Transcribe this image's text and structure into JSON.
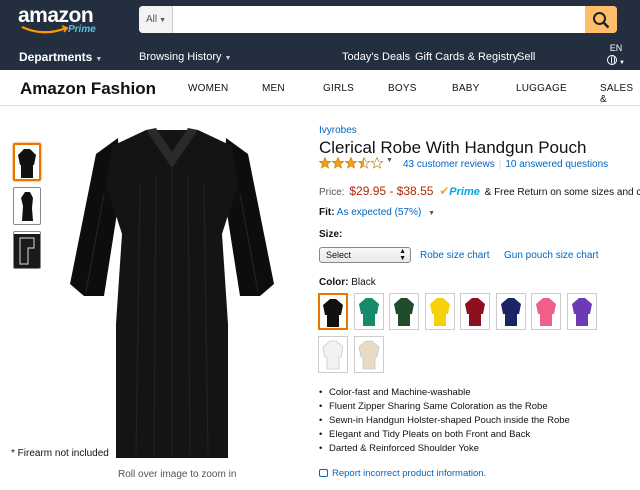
{
  "header": {
    "logo_text": "amazon",
    "logo_prime": "Prime",
    "search": {
      "category": "All",
      "value": "",
      "placeholder": ""
    },
    "departments": "Departments",
    "browsing_history": "Browsing History",
    "links": [
      "Today's Deals",
      "Gift Cards & Registry",
      "Sell"
    ],
    "language": "EN"
  },
  "subnav": {
    "brand": "Amazon Fashion",
    "categories": [
      "WOMEN",
      "MEN",
      "GIRLS",
      "BOYS",
      "BABY",
      "LUGGAGE",
      "SALES &"
    ]
  },
  "gallery": {
    "thumbnails": [
      "gown-front",
      "gown-side",
      "gown-pouch-detail"
    ],
    "selected_thumbnail": 0,
    "note": "* Firearm not included",
    "zoom_hint": "Roll over image to zoom in"
  },
  "product": {
    "brand": "Ivyrobes",
    "title": "Clerical Robe With Handgun Pouch",
    "rating": 3.5,
    "reviews": "43 customer reviews",
    "answered": "10 answered questions",
    "price_label": "Price:",
    "price": "$29.95 - $38.55",
    "prime": "Prime",
    "shipping": "& Free Return on some sizes and colors",
    "fit_label": "Fit:",
    "fit_value": "As expected (57%)",
    "size_label": "Size:",
    "size_select": "Select",
    "size_chart": "Robe size chart",
    "pouch_chart": "Gun pouch size chart",
    "color_label": "Color:",
    "color_value": "Black",
    "swatches": [
      {
        "name": "Black",
        "color": "#111111"
      },
      {
        "name": "Teal",
        "color": "#178a6e"
      },
      {
        "name": "Forest Green",
        "color": "#1f4d2b"
      },
      {
        "name": "Gold",
        "color": "#f5d10c"
      },
      {
        "name": "Maroon",
        "color": "#8e1020"
      },
      {
        "name": "Navy",
        "color": "#1c2466"
      },
      {
        "name": "Pink",
        "color": "#ee5f8a"
      },
      {
        "name": "Purple",
        "color": "#6a3bb4"
      },
      {
        "name": "White",
        "color": "#f2f2f2"
      },
      {
        "name": "Ivory",
        "color": "#e7dcc3"
      }
    ],
    "selected_swatch": 0,
    "bullets": [
      "Color-fast and Machine-washable",
      "Fluent Zipper Sharing Same Coloration as the Robe",
      "Sewn-in Handgun Holster-shaped Pouch inside the Robe",
      "Elegant and Tidy Pleats on both Front and Back",
      "Darted & Reinforced Shoulder Yoke"
    ],
    "report": "Report incorrect product information."
  },
  "colors": {
    "nav_bg": "#232f3e",
    "search_button": "#febd69",
    "link": "#0066c0",
    "price": "#b12704",
    "star": "#f0a01c",
    "selected_border": "#e77600"
  }
}
